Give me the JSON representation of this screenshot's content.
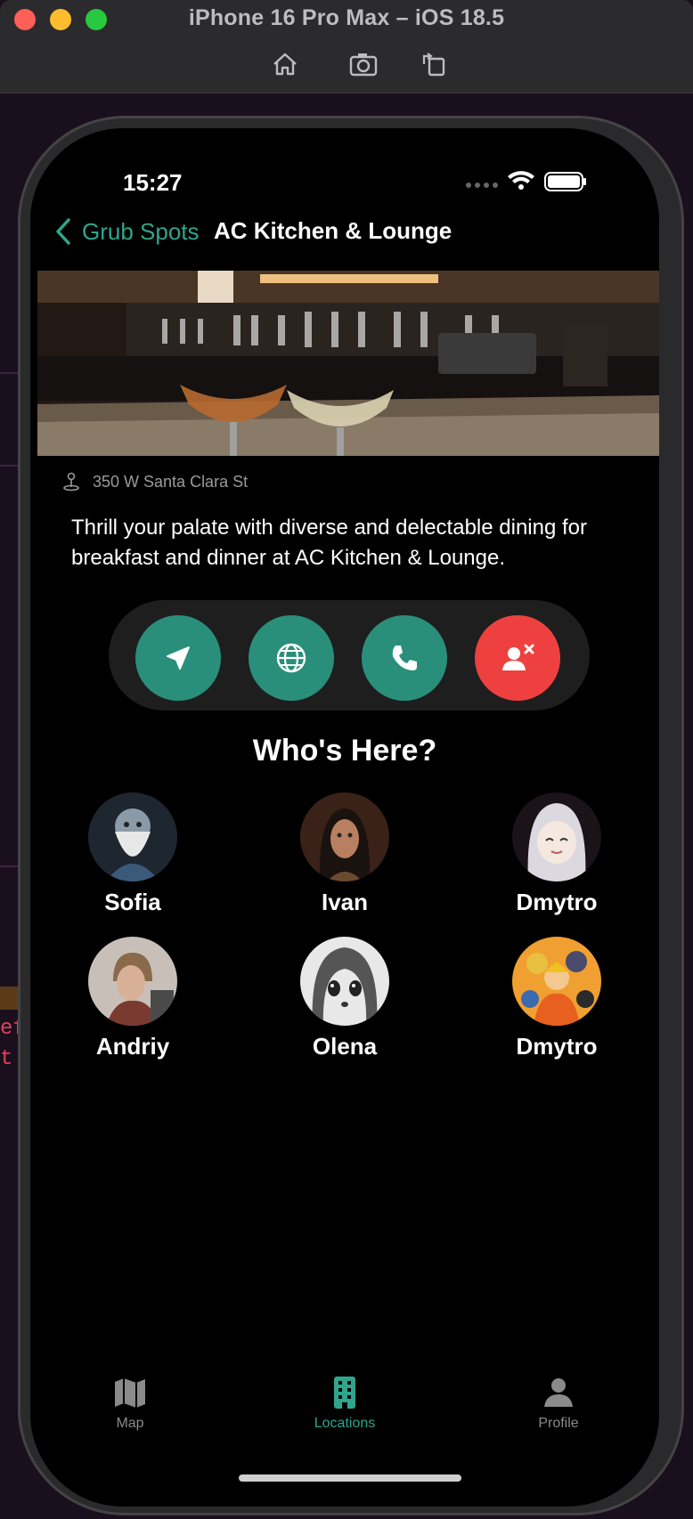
{
  "simulator": {
    "title": "iPhone 16 Pro Max – iOS 18.5",
    "tools": [
      "home-icon",
      "screenshot-icon",
      "rotate-icon"
    ]
  },
  "background_code": [
    "eft",
    "t ;"
  ],
  "status": {
    "time": "15:27"
  },
  "nav": {
    "back_label": "Grub Spots",
    "title": "AC Kitchen & Lounge"
  },
  "place": {
    "address": "350 W Santa Clara St",
    "description": "Thrill your palate with diverse and delectable dining for breakfast and dinner at AC Kitchen & Lounge."
  },
  "actions": [
    {
      "icon": "navigation-arrow-icon",
      "color": "#2a8f7a"
    },
    {
      "icon": "globe-icon",
      "color": "#2a8f7a"
    },
    {
      "icon": "phone-icon",
      "color": "#2a8f7a"
    },
    {
      "icon": "remove-person-icon",
      "color": "#ef4040"
    }
  ],
  "whos_here": {
    "title": "Who's Here?",
    "people": [
      {
        "name": "Sofia"
      },
      {
        "name": "Ivan"
      },
      {
        "name": "Dmytro"
      },
      {
        "name": "Andriy"
      },
      {
        "name": "Olena"
      },
      {
        "name": "Dmytro"
      }
    ]
  },
  "tabbar": {
    "tabs": [
      {
        "label": "Map",
        "icon": "map-icon",
        "active": false
      },
      {
        "label": "Locations",
        "icon": "building-icon",
        "active": true
      },
      {
        "label": "Profile",
        "icon": "person-icon",
        "active": false
      }
    ],
    "active_color": "#2fa58c",
    "inactive_color": "#8a8a8a"
  }
}
